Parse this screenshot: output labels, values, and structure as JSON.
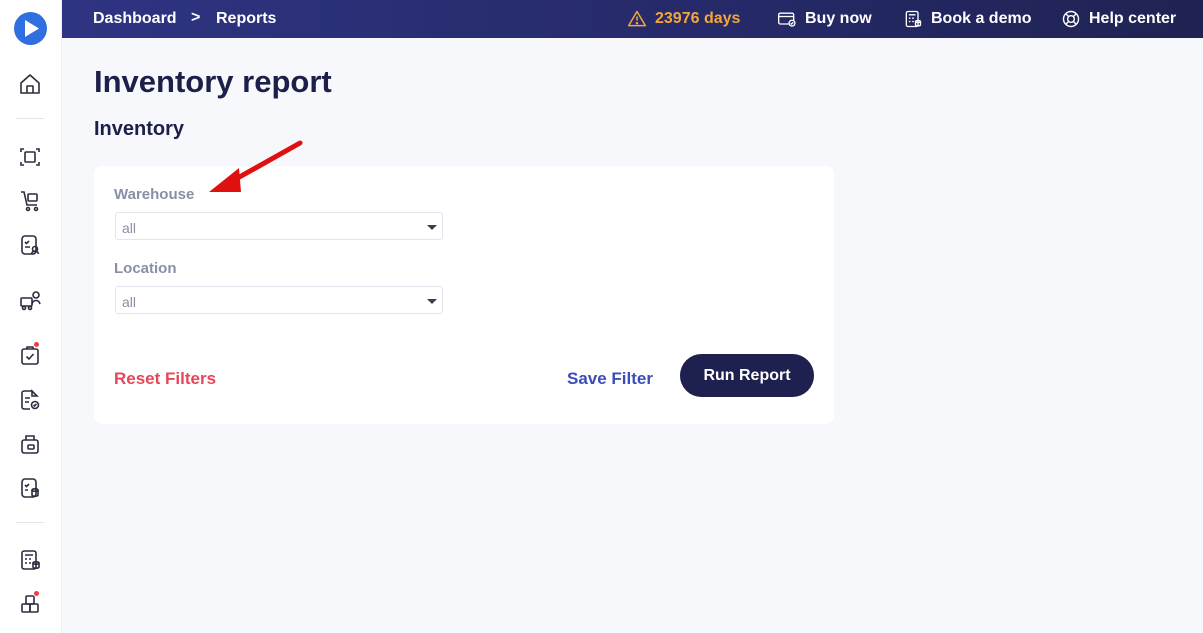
{
  "breadcrumb": {
    "home": "Dashboard",
    "separator": ">",
    "current": "Reports"
  },
  "topbar": {
    "trial": {
      "label": "23976 days",
      "color": "#f3a73a"
    },
    "buy_now": "Buy now",
    "book_demo": "Book a demo",
    "help_center": "Help center"
  },
  "page": {
    "title": "Inventory report",
    "section": "Inventory"
  },
  "filters": {
    "warehouse": {
      "label": "Warehouse",
      "value": "all"
    },
    "location": {
      "label": "Location",
      "value": "all"
    }
  },
  "actions": {
    "reset": "Reset Filters",
    "save": "Save Filter",
    "run": "Run Report"
  },
  "colors": {
    "accent": "#1e2050",
    "danger": "#e5475a",
    "link": "#3b4dbb",
    "annotation": "#e01010"
  },
  "sidebar": {
    "icons": [
      "home-icon",
      "scan-document-icon",
      "cart-icon",
      "checklist-user-icon",
      "truck-user-icon",
      "task-bag-icon",
      "document-check-icon",
      "box-icon",
      "checklist-database-icon",
      "calculator-icon",
      "boxes-icon"
    ]
  }
}
